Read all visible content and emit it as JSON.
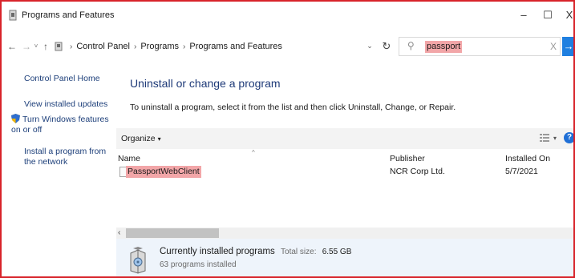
{
  "window": {
    "title": "Programs and Features",
    "minimize": "–",
    "maximize": "☐",
    "close": "X"
  },
  "address": {
    "back": "←",
    "forward": "→",
    "recent": "˅",
    "up": "↑",
    "crumbs": [
      "Control Panel",
      "Programs",
      "Programs and Features"
    ],
    "dropdown": "⌄",
    "refresh": "↻"
  },
  "search": {
    "value": "passport",
    "clear": "X",
    "go": "→"
  },
  "left_pane": {
    "home": "Control Panel Home",
    "updates": "View installed updates",
    "features": "Turn Windows features on or off",
    "install": "Install a program from the network"
  },
  "main": {
    "heading": "Uninstall or change a program",
    "description": "To uninstall a program, select it from the list and then click Uninstall, Change, or Repair.",
    "organize": "Organize",
    "organize_caret": "▾",
    "help": "?"
  },
  "table": {
    "columns": {
      "name": "Name",
      "publisher": "Publisher",
      "installed_on": "Installed On"
    },
    "sort_indicator": "^",
    "rows": [
      {
        "name": "PassportWebClient",
        "publisher": "NCR Corp Ltd.",
        "installed_on": "5/7/2021"
      }
    ]
  },
  "details": {
    "title": "Currently installed programs",
    "total_label": "Total size:",
    "total_value": "6.55 GB",
    "count": "63 programs installed"
  },
  "colors": {
    "highlight": "#f2a6a8",
    "border": "#d8232a",
    "link": "#1d3f7a",
    "heading": "#1e3a78",
    "accent": "#1f7fe0"
  }
}
